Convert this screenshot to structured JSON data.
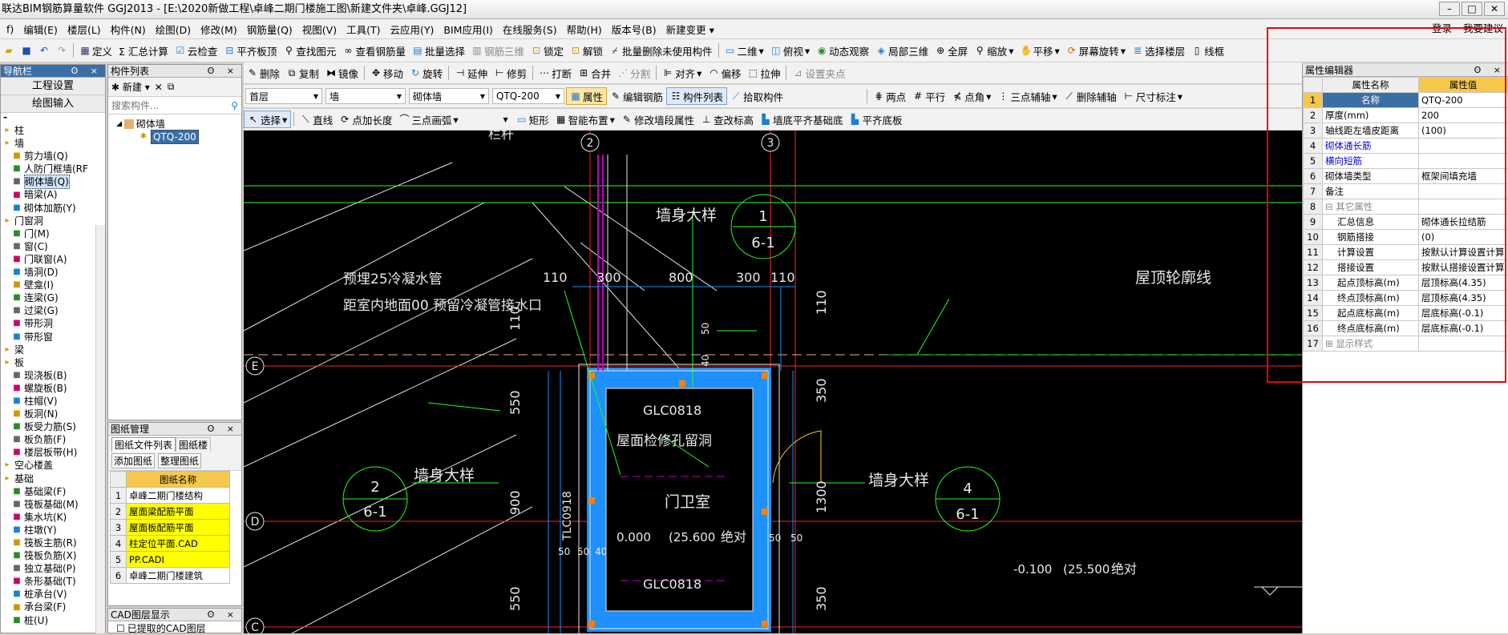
{
  "window": {
    "title": "联达BIM钢筋算量软件 GGJ2013 - [E:\\2020新做工程\\卓峰二期门楼施工图\\新建文件夹\\卓峰.GGJ12]",
    "controls": [
      "–",
      "□",
      "✕"
    ]
  },
  "menu": {
    "items": [
      "f)",
      "编辑(E)",
      "楼层(L)",
      "构件(N)",
      "绘图(D)",
      "修改(M)",
      "钢筋量(Q)",
      "视图(V)",
      "工具(T)",
      "云应用(Y)",
      "BIM应用(I)",
      "在线服务(S)",
      "帮助(H)",
      "版本号(B)",
      "新建变更 ▾"
    ],
    "right": [
      "登录",
      "我要建议"
    ]
  },
  "toolbar1": {
    "items": [
      "定义",
      "Σ 汇总计算",
      "云检查",
      "平齐板顶",
      "查找图元",
      "查看钢筋量",
      "批量选择",
      "钢筋三维",
      "锁定",
      "解锁",
      "批量删除未使用构件",
      "二维",
      "俯视",
      "动态观察",
      "局部三维",
      "全屏",
      "缩放",
      "平移",
      "屏幕旋转",
      "选择楼层",
      "线框"
    ]
  },
  "toolbar2": {
    "items": [
      "删除",
      "复制",
      "镜像",
      "移动",
      "旋转",
      "延伸",
      "修剪",
      "打断",
      "合并",
      "分割",
      "对齐",
      "偏移",
      "拉伸",
      "设置夹点"
    ]
  },
  "toolbar3": {
    "floor": "首层",
    "type": "墙",
    "subtype": "砌体墙",
    "component": "QTQ-200",
    "items": [
      "属性",
      "编辑钢筋",
      "构件列表",
      "拾取构件",
      "两点",
      "平行",
      "点角",
      "三点辅轴",
      "删除辅轴",
      "尺寸标注"
    ]
  },
  "toolbar4": {
    "items": [
      "选择",
      "直线",
      "点加长度",
      "三点画弧",
      "矩形",
      "智能布置",
      "修改墙段属性",
      "查改标高",
      "墙底平齐基础底",
      "平齐底板"
    ]
  },
  "nav": {
    "title": "导航栏",
    "btn1": "工程设置",
    "btn2": "绘图输入",
    "tree": [
      "柱",
      "墙",
      "剪力墙(Q)",
      "人防门框墙(RF",
      "砌体墙(Q)",
      "暗梁(A)",
      "砌体加筋(Y)",
      "门窗洞",
      "门(M)",
      "窗(C)",
      "门联窗(A)",
      "墙洞(D)",
      "壁龛(I)",
      "连梁(G)",
      "过梁(G)",
      "带形洞",
      "带形窗",
      "梁",
      "板",
      "现浇板(B)",
      "螺旋板(B)",
      "柱帽(V)",
      "板洞(N)",
      "板受力筋(S)",
      "板负筋(F)",
      "楼层板带(H)",
      "空心楼盖",
      "基础",
      "基础梁(F)",
      "筏板基础(M)",
      "集水坑(K)",
      "柱墩(Y)",
      "筏板主筋(R)",
      "筏板负筋(X)",
      "独立基础(P)",
      "条形基础(T)",
      "桩承台(V)",
      "承台梁(F)",
      "桩(U)"
    ]
  },
  "complist": {
    "title": "构件列表",
    "new": "新建",
    "search": "搜索构件...",
    "group": "砌体墙",
    "item": "QTQ-200"
  },
  "drawings": {
    "title": "图纸管理",
    "tab1": "图纸文件列表",
    "tab2": "图纸楼",
    "add": "添加图纸",
    "arrange": "整理图纸",
    "col": "图纸名称",
    "rows": [
      "卓峰二期门楼结构",
      "屋面梁配筋平面",
      "屋面板配筋平面",
      "柱定位平面.CAD",
      "PP.CADI",
      "卓峰二期门楼建筑"
    ]
  },
  "cadlayer": {
    "title": "CAD图层显示",
    "item": "已提取的CAD图层"
  },
  "prop": {
    "title": "属性编辑器",
    "col1": "属性名称",
    "col2": "属性值",
    "rows": [
      [
        "名称",
        "QTQ-200"
      ],
      [
        "厚度(mm)",
        "200"
      ],
      [
        "轴线距左墙皮距离",
        "(100)"
      ],
      [
        "砌体通长筋",
        ""
      ],
      [
        "横向短筋",
        ""
      ],
      [
        "砌体墙类型",
        "框架间填充墙"
      ],
      [
        "备注",
        ""
      ],
      [
        "其它属性",
        ""
      ],
      [
        "汇总信息",
        "砌体通长拉结筋"
      ],
      [
        "钢筋搭接",
        "(0)"
      ],
      [
        "计算设置",
        "按默认计算设置计算"
      ],
      [
        "搭接设置",
        "按默认搭接设置计算"
      ],
      [
        "起点顶标高(m)",
        "层顶标高(4.35)"
      ],
      [
        "终点顶标高(m)",
        "层顶标高(4.35)"
      ],
      [
        "起点底标高(m)",
        "层底标高(-0.1)"
      ],
      [
        "终点底标高(m)",
        "层底标高(-0.1)"
      ],
      [
        "显示样式",
        ""
      ]
    ]
  },
  "cad": {
    "texts": {
      "t1": "墙身大样",
      "t2": "屋顶轮廓线",
      "t3": "预埋25冷凝水管",
      "t4": "距室内地面00 预留冷凝管接水口",
      "t5": "GLC0818",
      "t6": "屋面检修孔留洞",
      "t7": "门卫室",
      "t8": "墙身大样",
      "t9": "墙身大样",
      "t10": "GLC0818",
      "t11": "0.000",
      "t12": "(25.600",
      "t13": "绝对",
      "t14": "-0.100",
      "t15": "(25.500",
      "t16": "绝对",
      "t17": "TLC0918",
      "t18": "栏杆"
    },
    "dims": [
      "110",
      "300",
      "800",
      "300",
      "110",
      "110",
      "550",
      "900",
      "550",
      "350",
      "1300",
      "350",
      "50",
      "40",
      "50",
      "50",
      "40",
      "50",
      "50"
    ],
    "bubbles": [
      [
        "1",
        "6-1"
      ],
      [
        "2",
        "6-1"
      ],
      [
        "4",
        "6-1"
      ]
    ],
    "axes": [
      "2",
      "3",
      "E",
      "E",
      "D",
      "D",
      "C",
      "C"
    ]
  }
}
